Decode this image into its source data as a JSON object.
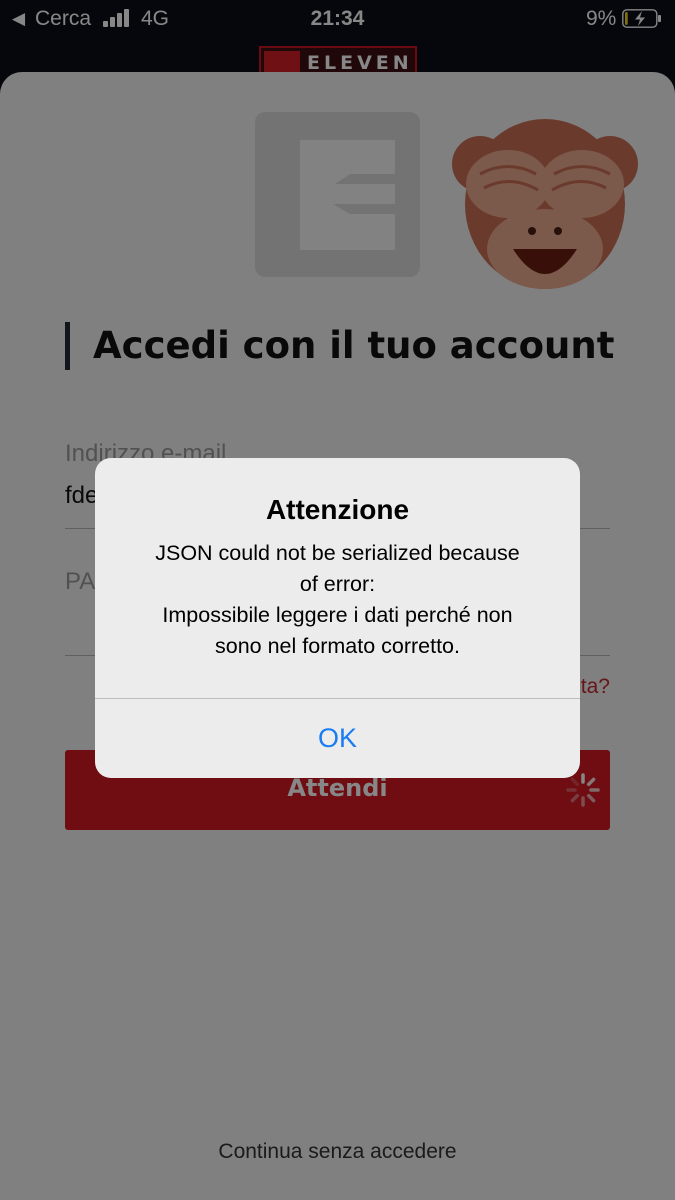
{
  "status_bar": {
    "back_label": "Cerca",
    "network": "4G",
    "time": "21:34",
    "battery_percent": "9%",
    "battery_level": 0.09,
    "signal_bars": 4
  },
  "brand": {
    "name": "ELEVEN"
  },
  "login": {
    "title": "Accedi con il tuo account",
    "email_label": "Indirizzo e-mail",
    "email_value": "fde",
    "password_label": "PA",
    "forgot_link": "ta?",
    "submit_label": "Attendi",
    "skip_link": "Continua senza accedere"
  },
  "alert": {
    "title": "Attenzione",
    "message_lines": [
      "JSON could not be serialized because",
      "of error:",
      "Impossibile leggere i dati perché non",
      "sono nel formato corretto."
    ],
    "ok_label": "OK"
  },
  "colors": {
    "brand_red": "#d11a23",
    "link_blue": "#1a7cf2",
    "status_bar_bg": "#0a0f17",
    "sheet_bg": "#f2f2f2"
  },
  "icons": [
    "back-arrow-icon",
    "signal-icon",
    "battery-charging-icon",
    "eleven-logo-icon",
    "see-no-evil-monkey-icon",
    "spinner-icon"
  ]
}
